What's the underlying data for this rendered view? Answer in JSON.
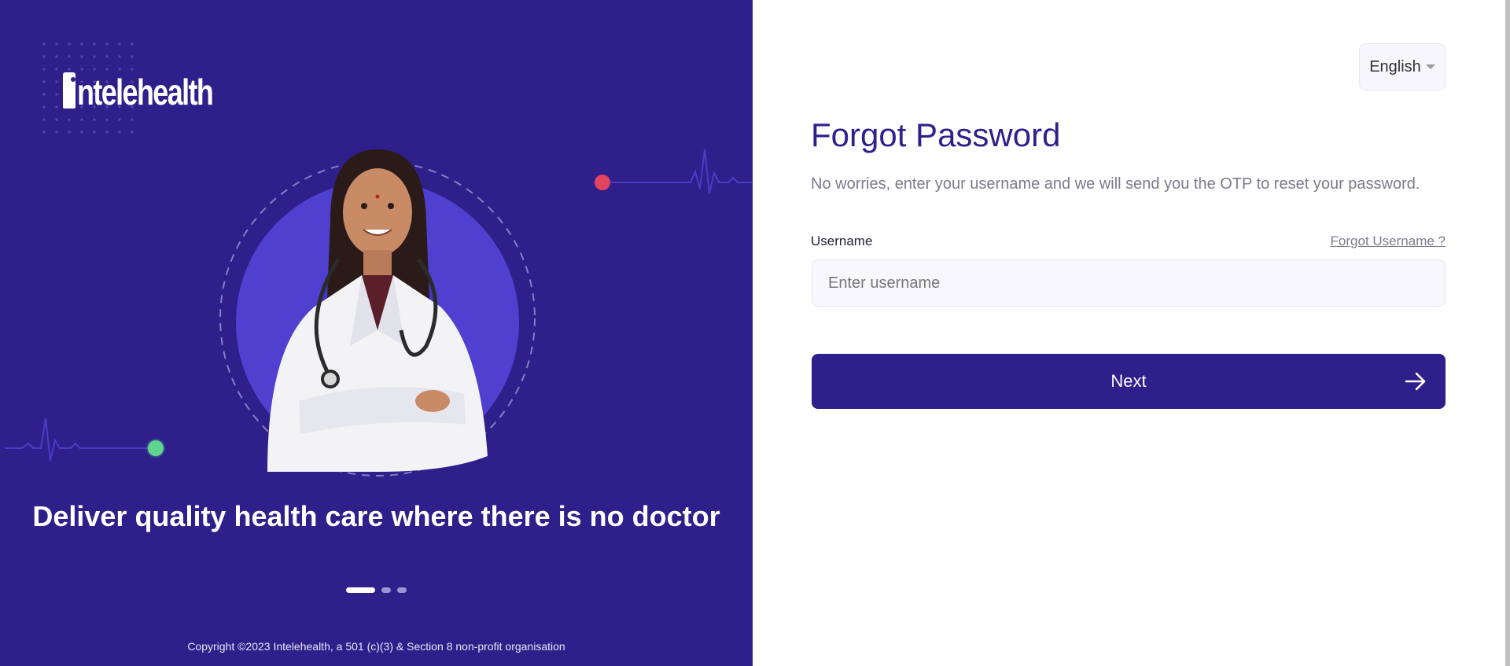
{
  "brand": {
    "name": "intelehealth",
    "colors": {
      "primary": "#2e1f8b",
      "accent_red": "#e2435e",
      "accent_green": "#5fd48e",
      "circle": "#4f40cf"
    }
  },
  "hero": {
    "heading": "Deliver quality health care where there is no doctor",
    "carousel": {
      "total": 3,
      "active_index": 0
    }
  },
  "footer": {
    "copyright": "Copyright ©2023 Intelehealth, a 501 (c)(3) & Section 8 non-profit organisation"
  },
  "language": {
    "selected": "English",
    "icon": "chevron-down-icon"
  },
  "form": {
    "title": "Forgot Password",
    "subtitle": "No worries, enter your username and we will send you the OTP to reset your password.",
    "username_label": "Username",
    "forgot_username_link": "Forgot Username ?",
    "username_placeholder": "Enter username",
    "username_value": "",
    "next_label": "Next",
    "next_icon": "arrow-right-icon"
  }
}
